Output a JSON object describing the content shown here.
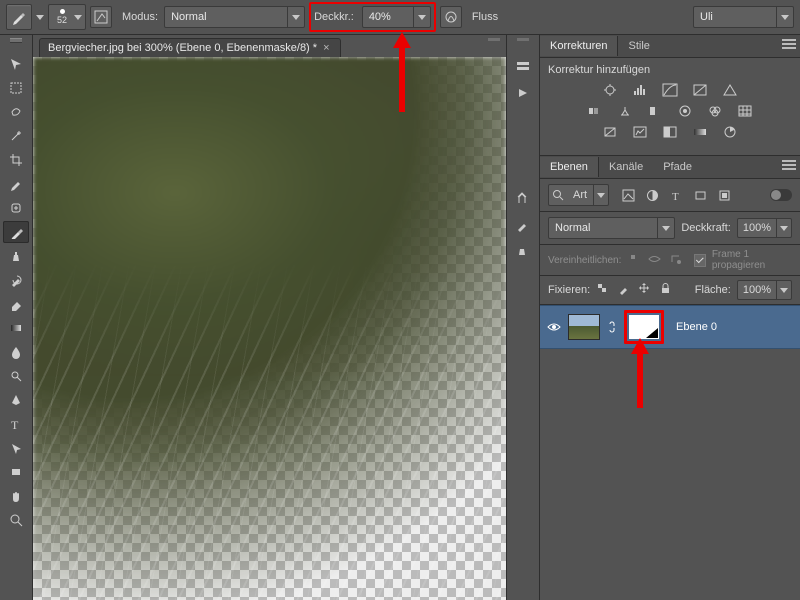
{
  "options_bar": {
    "brush_size": "52",
    "mode_label": "Modus:",
    "mode_value": "Normal",
    "opacity_label": "Deckkr.:",
    "opacity_value": "40%",
    "flow_label": "Fluss",
    "workspace_value": "Uli"
  },
  "document_tab": {
    "title": "Bergviecher.jpg bei 300% (Ebene 0, Ebenenmaske/8) *"
  },
  "panels": {
    "adjustments": {
      "tab_active": "Korrekturen",
      "tab_other": "Stile",
      "heading": "Korrektur hinzufügen"
    },
    "layers": {
      "tab_active": "Ebenen",
      "tab_channels": "Kanäle",
      "tab_paths": "Pfade",
      "kind_value": "Art",
      "blend_value": "Normal",
      "opacity_label": "Deckkraft:",
      "opacity_value": "100%",
      "unify_label": "Vereinheitlichen:",
      "propagate_label": "Frame 1 propagieren",
      "lock_label": "Fixieren:",
      "fill_label": "Fläche:",
      "fill_value": "100%",
      "layer0_name": "Ebene 0"
    }
  }
}
